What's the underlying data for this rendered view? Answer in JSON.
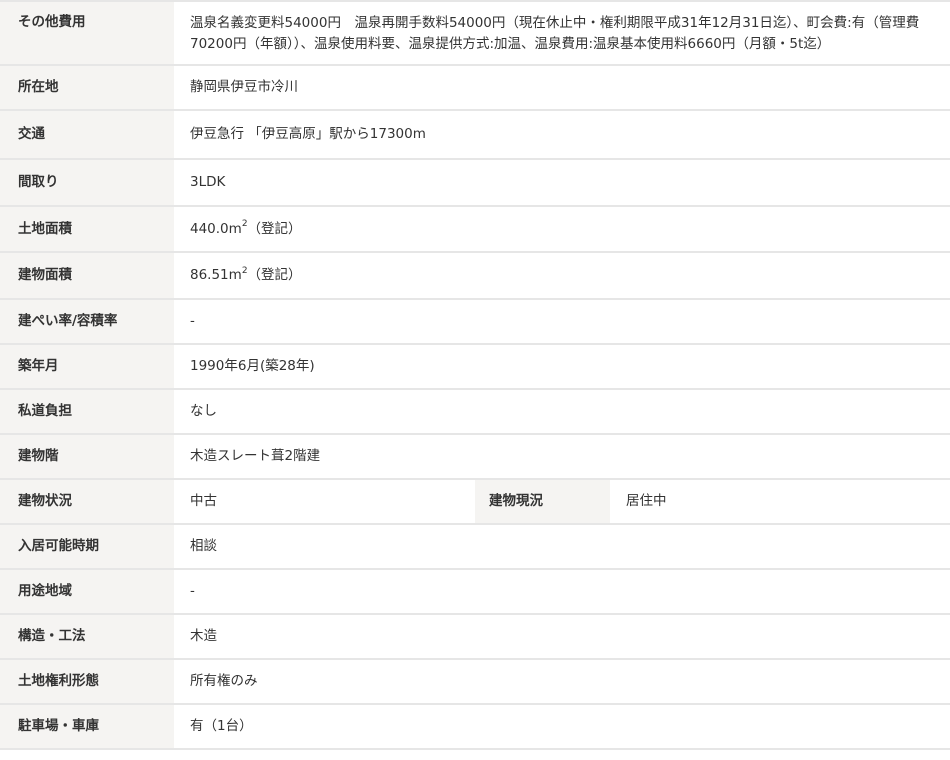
{
  "rows": [
    {
      "label": "その他費用",
      "value": "温泉名義変更料54000円　温泉再開手数料54000円（現在休止中・権利期限平成31年12月31日迄）、町会費:有（管理費70200円（年額））、温泉使用料要、温泉提供方式:加温、温泉費用:温泉基本使用料6660円（月額・5t迄）"
    },
    {
      "label": "所在地",
      "value": "静岡県伊豆市冷川"
    },
    {
      "label": "交通",
      "value": "伊豆急行 「伊豆高原」駅から17300m"
    },
    {
      "label": "間取り",
      "value": "3LDK"
    },
    {
      "label": "土地面積",
      "value_main": "440.0m",
      "value_sup": "2",
      "value_suffix": "（登記）"
    },
    {
      "label": "建物面積",
      "value_main": "86.51m",
      "value_sup": "2",
      "value_suffix": "（登記）"
    },
    {
      "label": "建ぺい率/容積率",
      "value": "-"
    },
    {
      "label": "築年月",
      "value": "1990年6月(築28年)"
    },
    {
      "label": "私道負担",
      "value": "なし"
    },
    {
      "label": "建物階",
      "value": "木造スレート葺2階建"
    },
    {
      "label": "建物状況",
      "value": "中古",
      "label2": "建物現況",
      "value2": "居住中"
    },
    {
      "label": "入居可能時期",
      "value": "相談"
    },
    {
      "label": "用途地域",
      "value": "-"
    },
    {
      "label": "構造・工法",
      "value": "木造"
    },
    {
      "label": "土地権利形態",
      "value": "所有権のみ"
    },
    {
      "label": "駐車場・車庫",
      "value": "有（1台）"
    }
  ]
}
